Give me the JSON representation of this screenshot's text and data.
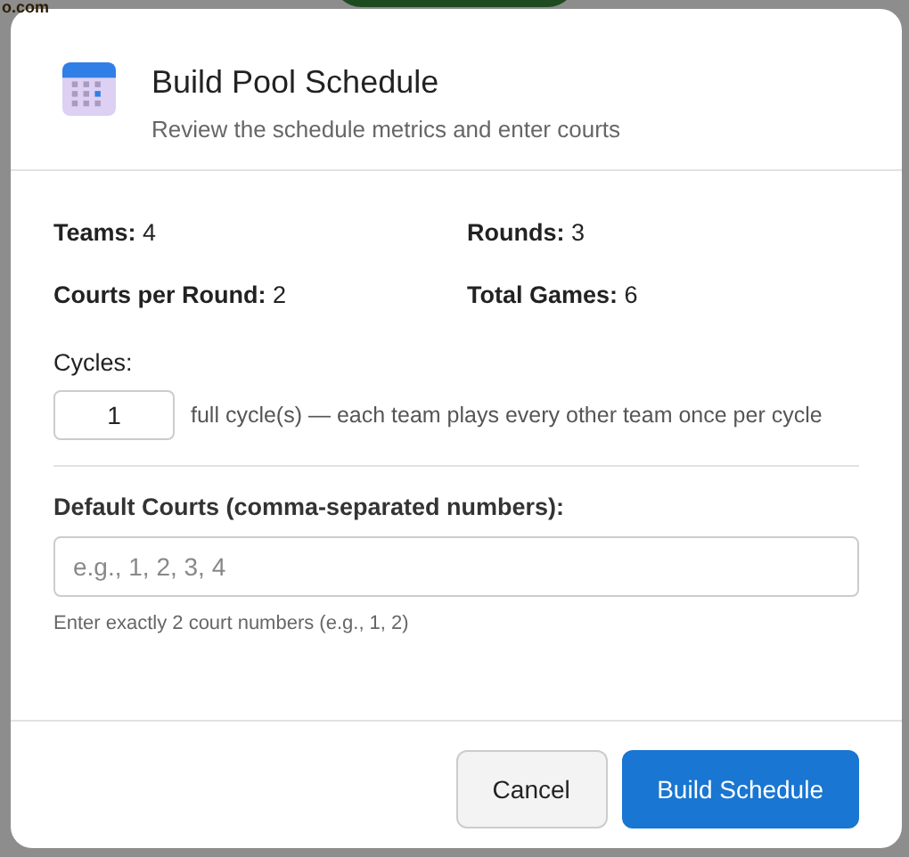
{
  "background": {
    "text": "o.com"
  },
  "dialog": {
    "title": "Build Pool Schedule",
    "subtitle": "Review the schedule metrics and enter courts",
    "metrics": [
      {
        "label": "Teams:",
        "value": "4"
      },
      {
        "label": "Rounds:",
        "value": "3"
      },
      {
        "label": "Courts per Round:",
        "value": "2"
      },
      {
        "label": "Total Games:",
        "value": "6"
      }
    ],
    "cycles": {
      "label": "Cycles:",
      "value": "1",
      "note": "full cycle(s) — each team plays every other team once per cycle"
    },
    "courts": {
      "label": "Default Courts (comma-separated numbers):",
      "placeholder": "e.g., 1, 2, 3, 4",
      "hint": "Enter exactly 2 court numbers (e.g., 1, 2)"
    },
    "buttons": [
      {
        "label": "Cancel",
        "kind": "secondary"
      },
      {
        "label": "Build Schedule",
        "kind": "primary"
      }
    ]
  }
}
